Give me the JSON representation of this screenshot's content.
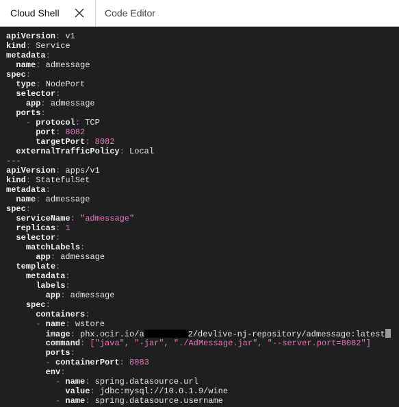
{
  "tabs": [
    {
      "label": "Cloud Shell",
      "active": true
    },
    {
      "label": "Code Editor",
      "active": false
    }
  ],
  "colors": {
    "background": "#1f1f1f",
    "key": "#f0f0f0",
    "punct": "#c678dd",
    "number": "#e879c0"
  },
  "lines": [
    [
      {
        "t": "k",
        "x": "apiVersion"
      },
      {
        "t": "p",
        "x": ":"
      },
      {
        "t": "v",
        "x": " v1"
      }
    ],
    [
      {
        "t": "k",
        "x": "kind"
      },
      {
        "t": "p",
        "x": ":"
      },
      {
        "t": "v",
        "x": " Service"
      }
    ],
    [
      {
        "t": "k",
        "x": "metadata"
      },
      {
        "t": "p",
        "x": ":"
      }
    ],
    [
      {
        "t": "v",
        "x": "  "
      },
      {
        "t": "k",
        "x": "name"
      },
      {
        "t": "p",
        "x": ":"
      },
      {
        "t": "v",
        "x": " admessage"
      }
    ],
    [
      {
        "t": "k",
        "x": "spec"
      },
      {
        "t": "p",
        "x": ":"
      }
    ],
    [
      {
        "t": "v",
        "x": "  "
      },
      {
        "t": "k",
        "x": "type"
      },
      {
        "t": "p",
        "x": ":"
      },
      {
        "t": "v",
        "x": " NodePort"
      }
    ],
    [
      {
        "t": "v",
        "x": "  "
      },
      {
        "t": "k",
        "x": "selector"
      },
      {
        "t": "p",
        "x": ":"
      }
    ],
    [
      {
        "t": "v",
        "x": "    "
      },
      {
        "t": "k",
        "x": "app"
      },
      {
        "t": "p",
        "x": ":"
      },
      {
        "t": "v",
        "x": " admessage"
      }
    ],
    [
      {
        "t": "v",
        "x": "  "
      },
      {
        "t": "k",
        "x": "ports"
      },
      {
        "t": "p",
        "x": ":"
      }
    ],
    [
      {
        "t": "v",
        "x": "    "
      },
      {
        "t": "p",
        "x": "-"
      },
      {
        "t": "v",
        "x": " "
      },
      {
        "t": "k",
        "x": "protocol"
      },
      {
        "t": "p",
        "x": ":"
      },
      {
        "t": "v",
        "x": " TCP"
      }
    ],
    [
      {
        "t": "v",
        "x": "      "
      },
      {
        "t": "k",
        "x": "port"
      },
      {
        "t": "p",
        "x": ":"
      },
      {
        "t": "n",
        "x": " 8082"
      }
    ],
    [
      {
        "t": "v",
        "x": "      "
      },
      {
        "t": "k",
        "x": "targetPort"
      },
      {
        "t": "p",
        "x": ":"
      },
      {
        "t": "n",
        "x": " 8082"
      }
    ],
    [
      {
        "t": "v",
        "x": "  "
      },
      {
        "t": "k",
        "x": "externalTrafficPolicy"
      },
      {
        "t": "p",
        "x": ":"
      },
      {
        "t": "v",
        "x": " Local"
      }
    ],
    [
      {
        "t": "p",
        "x": "---"
      }
    ],
    [
      {
        "t": "k",
        "x": "apiVersion"
      },
      {
        "t": "p",
        "x": ":"
      },
      {
        "t": "v",
        "x": " apps/v1"
      }
    ],
    [
      {
        "t": "k",
        "x": "kind"
      },
      {
        "t": "p",
        "x": ":"
      },
      {
        "t": "v",
        "x": " StatefulSet"
      }
    ],
    [
      {
        "t": "k",
        "x": "metadata"
      },
      {
        "t": "p",
        "x": ":"
      }
    ],
    [
      {
        "t": "v",
        "x": "  "
      },
      {
        "t": "k",
        "x": "name"
      },
      {
        "t": "p",
        "x": ":"
      },
      {
        "t": "v",
        "x": " admessage"
      }
    ],
    [
      {
        "t": "k",
        "x": "spec"
      },
      {
        "t": "p",
        "x": ":"
      }
    ],
    [
      {
        "t": "v",
        "x": "  "
      },
      {
        "t": "k",
        "x": "serviceName"
      },
      {
        "t": "p",
        "x": ":"
      },
      {
        "t": "s",
        "x": " \"admessage\""
      }
    ],
    [
      {
        "t": "v",
        "x": "  "
      },
      {
        "t": "k",
        "x": "replicas"
      },
      {
        "t": "p",
        "x": ":"
      },
      {
        "t": "n",
        "x": " 1"
      }
    ],
    [
      {
        "t": "v",
        "x": "  "
      },
      {
        "t": "k",
        "x": "selector"
      },
      {
        "t": "p",
        "x": ":"
      }
    ],
    [
      {
        "t": "v",
        "x": "    "
      },
      {
        "t": "k",
        "x": "matchLabels"
      },
      {
        "t": "p",
        "x": ":"
      }
    ],
    [
      {
        "t": "v",
        "x": "      "
      },
      {
        "t": "k",
        "x": "app"
      },
      {
        "t": "p",
        "x": ":"
      },
      {
        "t": "v",
        "x": " admessage"
      }
    ],
    [
      {
        "t": "v",
        "x": "  "
      },
      {
        "t": "k",
        "x": "template"
      },
      {
        "t": "p",
        "x": ":"
      }
    ],
    [
      {
        "t": "v",
        "x": "    "
      },
      {
        "t": "k",
        "x": "metadata"
      },
      {
        "t": "p",
        "x": ":"
      }
    ],
    [
      {
        "t": "v",
        "x": "      "
      },
      {
        "t": "k",
        "x": "labels"
      },
      {
        "t": "p",
        "x": ":"
      }
    ],
    [
      {
        "t": "v",
        "x": "        "
      },
      {
        "t": "k",
        "x": "app"
      },
      {
        "t": "p",
        "x": ":"
      },
      {
        "t": "v",
        "x": " admessage"
      }
    ],
    [
      {
        "t": "v",
        "x": "    "
      },
      {
        "t": "k",
        "x": "spec"
      },
      {
        "t": "p",
        "x": ":"
      }
    ],
    [
      {
        "t": "v",
        "x": "      "
      },
      {
        "t": "k",
        "x": "containers"
      },
      {
        "t": "p",
        "x": ":"
      }
    ],
    [
      {
        "t": "v",
        "x": "      "
      },
      {
        "t": "p",
        "x": "-"
      },
      {
        "t": "v",
        "x": " "
      },
      {
        "t": "k",
        "x": "name"
      },
      {
        "t": "p",
        "x": ":"
      },
      {
        "t": "v",
        "x": " wstore"
      }
    ],
    [
      {
        "t": "v",
        "x": "        "
      },
      {
        "t": "k",
        "x": "image"
      },
      {
        "t": "p",
        "x": ":"
      },
      {
        "t": "v",
        "x": " phx.ocir.io/a"
      },
      {
        "t": "r",
        "x": ""
      },
      {
        "t": "v",
        "x": "2/devlive-nj-repository/admessage:latest"
      },
      {
        "t": "c",
        "x": ""
      }
    ],
    [
      {
        "t": "v",
        "x": "        "
      },
      {
        "t": "k",
        "x": "command"
      },
      {
        "t": "p",
        "x": ":"
      },
      {
        "t": "s",
        "x": " [\"java\", \"-jar\", \"./AdMessage.jar\", \"--server.port=8082\"]"
      }
    ],
    [
      {
        "t": "v",
        "x": "        "
      },
      {
        "t": "k",
        "x": "ports"
      },
      {
        "t": "p",
        "x": ":"
      }
    ],
    [
      {
        "t": "v",
        "x": "        "
      },
      {
        "t": "p",
        "x": "-"
      },
      {
        "t": "v",
        "x": " "
      },
      {
        "t": "k",
        "x": "containerPort"
      },
      {
        "t": "p",
        "x": ":"
      },
      {
        "t": "n",
        "x": " 8083"
      }
    ],
    [
      {
        "t": "v",
        "x": "        "
      },
      {
        "t": "k",
        "x": "env"
      },
      {
        "t": "p",
        "x": ":"
      }
    ],
    [
      {
        "t": "v",
        "x": "          "
      },
      {
        "t": "p",
        "x": "-"
      },
      {
        "t": "v",
        "x": " "
      },
      {
        "t": "k",
        "x": "name"
      },
      {
        "t": "p",
        "x": ":"
      },
      {
        "t": "v",
        "x": " spring.datasource.url"
      }
    ],
    [
      {
        "t": "v",
        "x": "            "
      },
      {
        "t": "k",
        "x": "value"
      },
      {
        "t": "p",
        "x": ":"
      },
      {
        "t": "v",
        "x": " jdbc:mysql://10.0.1.9/wine"
      }
    ],
    [
      {
        "t": "v",
        "x": "          "
      },
      {
        "t": "p",
        "x": "-"
      },
      {
        "t": "v",
        "x": " "
      },
      {
        "t": "k",
        "x": "name"
      },
      {
        "t": "p",
        "x": ":"
      },
      {
        "t": "v",
        "x": " spring.datasource.username"
      }
    ]
  ]
}
